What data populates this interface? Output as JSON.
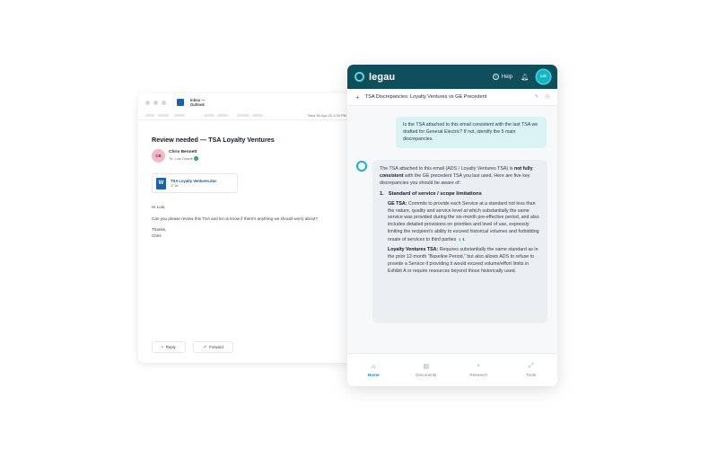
{
  "outlook": {
    "app_title": "Inbox —",
    "app_subtitle": "Outlook",
    "date": "Wed 28-Apr-20 1:26 PM",
    "subject": "Review needed — TSA Loyalty Ventures",
    "sender": {
      "initials": "CB",
      "name": "Chris Bennett",
      "to": "To: Luis Duarte"
    },
    "attachment": {
      "name": "TSA Loyalty Ventures.doc",
      "size": "37 kB",
      "icon_letter": "W"
    },
    "body": {
      "greeting": "Hi Luis,",
      "text": "Can you please review this TSA and let us know if there's anything we should worry about?",
      "signoff": "Thanks,",
      "signature": "Chris"
    },
    "actions": {
      "reply": "Reply",
      "forward": "Forward"
    }
  },
  "legau": {
    "brand": "legau",
    "help": "Help",
    "user_initials": "LD",
    "conversation_title": "TSA Discrepancies: Loyalty Ventures vs GE Precedent",
    "user_message": "Is the TSA attached to this email consistent with the last TSA we drafted for General Electric? If not, identify the 5 main discrepancies.",
    "bot": {
      "intro_1": "The TSA attached to this email (ADS / Loyalty Ventures TSA) is ",
      "intro_bold": "not fully consistent",
      "intro_2": " with the GE precedent TSA you last used. Here are five key discrepancies you should be aware of:",
      "item_number": "1.",
      "item_title": "Standard of service / scope limitations",
      "ge_label": "GE TSA:",
      "ge_text": " Commits to provide each Service at a standard not less than the nature, quality and service level at which substantially the same service was provided during the six-month pre-effective period, and also includes detailed provisions on priorities and level of use, expressly limiting the recipient’s ability to exceed historical volumes and forbidding resale of services to third parties",
      "ge_cites": "1 ⬇",
      "lv_label": "Loyalty Ventures TSA:",
      "lv_text": " Requires substantially the same standard as in the prior 12-month “Baseline Period,” but also allows ADS to refuse to provide a Service if providing it would exceed volume/effort limits in Exhibit A or require resources beyond those historically used."
    },
    "nav": [
      {
        "label": "Home",
        "icon": "⌂",
        "active": true
      },
      {
        "label": "Documents",
        "icon": "▤",
        "active": false
      },
      {
        "label": "Research",
        "icon": "⌕",
        "active": false
      },
      {
        "label": "Tools",
        "icon": "⤢",
        "active": false
      }
    ]
  }
}
